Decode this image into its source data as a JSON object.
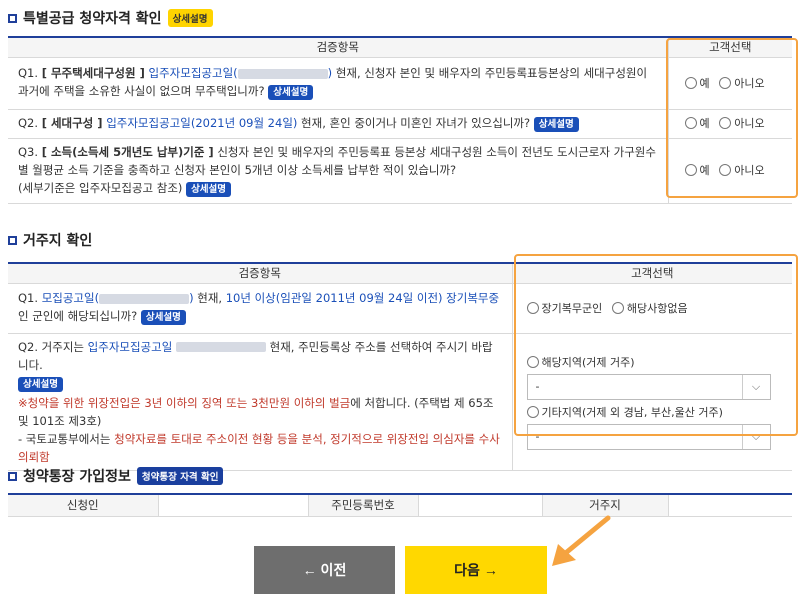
{
  "section1": {
    "title": "특별공급 청약자격 확인",
    "badge": "상세설명",
    "col_check": "검증항목",
    "col_choice": "고객선택",
    "q1": {
      "prefix": "Q1.",
      "bold": "[ 무주택세대구성원 ]",
      "link": "입주자모집공고일(",
      "link_end": ")",
      "text": "현재, 신청자 본인 및 배우자의 주민등록표등본상의 세대구성원이 과거에 주택을 소유한 사실이 없으며 무주택입니까?",
      "badge": "상세설명"
    },
    "q2": {
      "prefix": "Q2.",
      "bold": "[ 세대구성 ]",
      "link": "입주자모집공고일(2021년 09월 24일)",
      "text": "현재, 혼인 중이거나 미혼인 자녀가 있으십니까?",
      "badge": "상세설명"
    },
    "q3": {
      "prefix": "Q3.",
      "bold": "[ 소득(소득세 5개년도 납부)기준 ]",
      "text": "신청자 본인 및 배우자의 주민등록표 등본상 세대구성원 소득이 전년도 도시근로자 가구원수별 월평균 소득 기준을 충족하고 신청자 본인이 5개년 이상 소득세를 납부한 적이 있습니까?",
      "text2": "(세부기준은 입주자모집공고 참조)",
      "badge": "상세설명"
    },
    "yes": "예",
    "no": "아니오"
  },
  "section2": {
    "title": "거주지 확인",
    "col_check": "검증항목",
    "col_choice": "고객선택",
    "q1": {
      "prefix": "Q1.",
      "link": "모집공고일(",
      "link_end": ")",
      "text_a": "현재,",
      "blue_a": "10년 이상(임관일 2011년 09월 24일 이전)",
      "blue_b": "장기복무중",
      "text_b": "인 군인에 해당되십니까?",
      "badge": "상세설명"
    },
    "q1_opt1": "장기복무군인",
    "q1_opt2": "해당사항없음",
    "q2": {
      "prefix": "Q2. 거주지는",
      "link": "입주자모집공고일",
      "text": "현재, 주민등록상 주소를 선택하여 주시기 바랍니다.",
      "badge": "상세설명",
      "note_prefix": "※",
      "note_red1": "청약을 위한 위장전입은 3년 이하의 징역 또는 3천만원 이하의 벌금",
      "note_text1": "에 처합니다. (주택법 제 65조 및 101조 제3호)",
      "note_text2": "- 국토교통부에서는",
      "note_red2": "청약자료를 토대로 주소이전 현황 등을 분석, 정기적으로 위장전입 의심자를 수사의뢰함"
    },
    "region1_label": "해당지역(거제 거주)",
    "region1_value": "-",
    "region2_label": "기타지역(거제 외 경남, 부산,울산 거주)",
    "region2_value": "-"
  },
  "section3": {
    "title": "청약통장 가입정보",
    "badge": "청약통장 자격 확인",
    "cols": [
      "신청인",
      "",
      "주민등록번호",
      "",
      "거주지",
      ""
    ]
  },
  "buttons": {
    "prev": "← 이전",
    "next": "다음 →"
  }
}
